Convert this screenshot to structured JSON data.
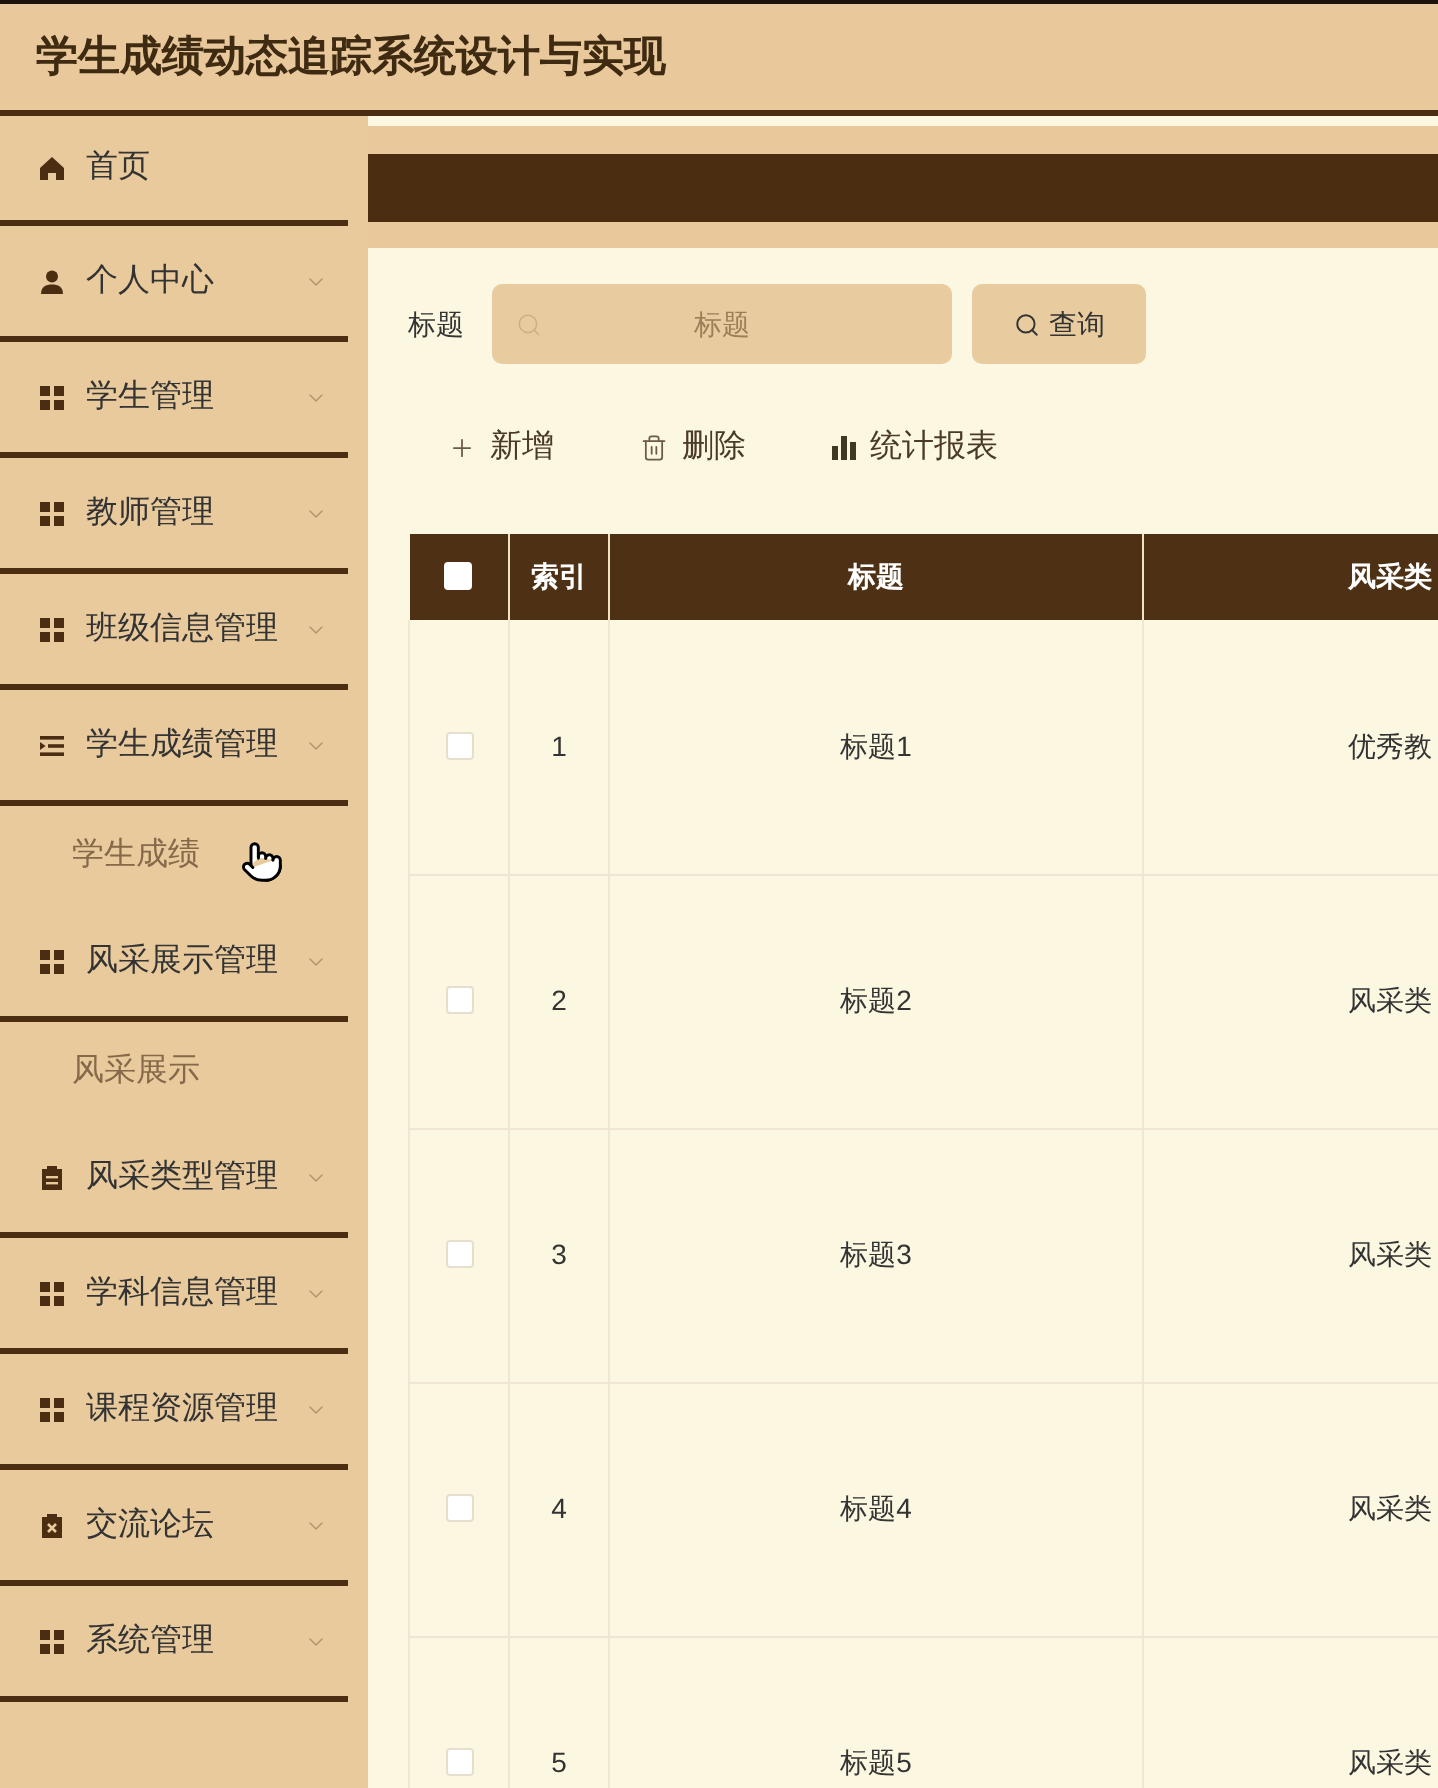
{
  "header": {
    "title": "学生成绩动态追踪系统设计与实现"
  },
  "sidebar": {
    "items": [
      {
        "label": "首页",
        "kind": "link"
      },
      {
        "label": "个人中心",
        "kind": "submenu"
      },
      {
        "label": "学生管理",
        "kind": "submenu"
      },
      {
        "label": "教师管理",
        "kind": "submenu"
      },
      {
        "label": "班级信息管理",
        "kind": "submenu"
      },
      {
        "label": "学生成绩管理",
        "kind": "submenu",
        "children": [
          {
            "label": "学生成绩"
          }
        ]
      },
      {
        "label": "风采展示管理",
        "kind": "submenu",
        "children": [
          {
            "label": "风采展示"
          }
        ]
      },
      {
        "label": "风采类型管理",
        "kind": "submenu"
      },
      {
        "label": "学科信息管理",
        "kind": "submenu"
      },
      {
        "label": "课程资源管理",
        "kind": "submenu"
      },
      {
        "label": "交流论坛",
        "kind": "submenu"
      },
      {
        "label": "系统管理",
        "kind": "submenu"
      }
    ]
  },
  "search": {
    "label": "标题",
    "placeholder": "标题",
    "button": "查询"
  },
  "toolbar": [
    {
      "label": "新增"
    },
    {
      "label": "删除"
    },
    {
      "label": "统计报表"
    }
  ],
  "table": {
    "header_checkbox": {
      "checked": false
    },
    "columns": [
      "索引",
      "标题",
      "风采类"
    ],
    "rows": [
      {
        "checked": false,
        "cells": [
          "1",
          "标题1",
          "优秀教"
        ]
      },
      {
        "checked": false,
        "cells": [
          "2",
          "标题2",
          "风采类"
        ]
      },
      {
        "checked": false,
        "cells": [
          "3",
          "标题3",
          "风采类"
        ]
      },
      {
        "checked": false,
        "cells": [
          "4",
          "标题4",
          "风采类"
        ]
      },
      {
        "checked": false,
        "cells": [
          "5",
          "标题5",
          "风采类"
        ]
      }
    ]
  }
}
